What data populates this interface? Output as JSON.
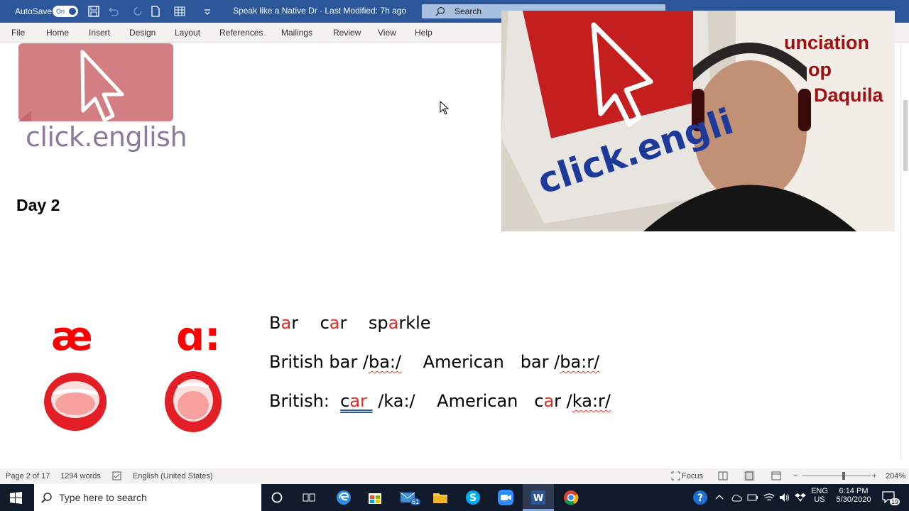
{
  "titlebar": {
    "autosave_label": "AutoSave",
    "autosave_state": "On",
    "doc_title": "Speak like a Native Dr  ·  Last Modified: 7h ago",
    "search_placeholder": "Search"
  },
  "menu": [
    "File",
    "Home",
    "Insert",
    "Design",
    "Layout",
    "References",
    "Mailings",
    "Review",
    "View",
    "Help"
  ],
  "document": {
    "logo_text": "click.english",
    "heading": "Day 2",
    "symbol_left": "æ",
    "symbol_right": "ɑ:",
    "line1_parts": [
      "B",
      "a",
      "r    c",
      "a",
      "r    sp",
      "a",
      "rkle"
    ],
    "line2_a": "British bar /",
    "line2_b": "ba:/",
    "line2_c": "    American   bar /",
    "line2_d": "ba:r/",
    "line3_a": "British:  ",
    "line3_b": "car ",
    "line3_c": " /ka:/    American   c",
    "line3_d": "a",
    "line3_e": "r /",
    "line3_f": "ka:r/"
  },
  "webcam": {
    "overlay_lines": [
      "unciation",
      "op",
      "Daquila"
    ],
    "sign_text": "click.engli"
  },
  "status": {
    "page": "Page 2 of 17",
    "words": "1294 words",
    "language": "English (United States)",
    "focus": "Focus",
    "zoom": "204%"
  },
  "taskbar": {
    "search_placeholder": "Type here to search",
    "mail_badge": "61",
    "lang1": "ENG",
    "lang2": "US",
    "time": "6:14 PM",
    "date": "5/30/2020",
    "notif_count": "19"
  }
}
